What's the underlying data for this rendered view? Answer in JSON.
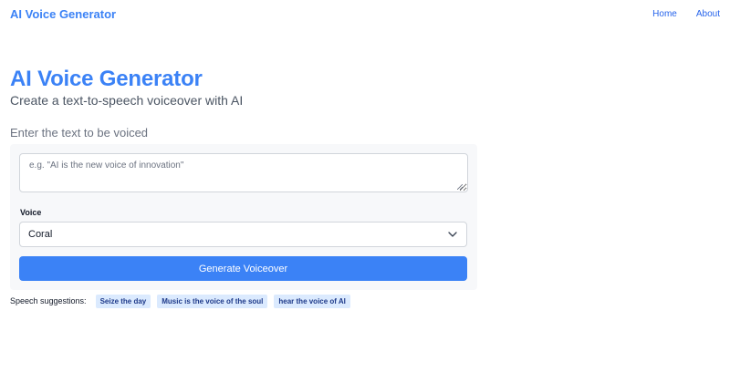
{
  "nav": {
    "brand": "AI Voice Generator",
    "links": [
      "Home",
      "About"
    ],
    "accent_color": "#3b82f6"
  },
  "hero": {
    "title": "AI Voice Generator",
    "subtitle": "Create a text-to-speech voiceover with AI"
  },
  "form": {
    "prompt_label": "Enter the text to be voiced",
    "text_input": {
      "value": "",
      "placeholder": "e.g. \"AI is the new voice of innovation\""
    },
    "voice_label": "Voice",
    "voice_selected": "Coral",
    "generate_label": "Generate Voiceover",
    "button_color": "#3b82f6"
  },
  "suggestions": {
    "label": "Speech suggestions:",
    "items": [
      "Seize the day",
      "Music is the voice of the soul",
      "hear the voice of AI"
    ],
    "chip_color": "#dbeafe"
  }
}
